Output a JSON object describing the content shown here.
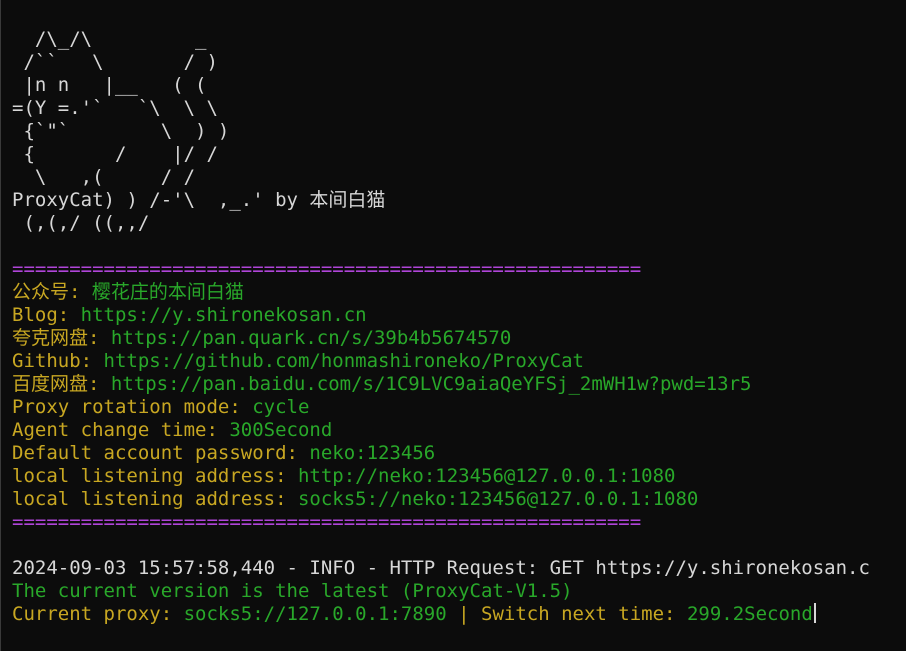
{
  "ascii_art": [
    "  /\\_/\\         _",
    " /``   \\       / )",
    " |n n   |__   ( (",
    "=(Y =.'`   `\\  \\ \\",
    " {`\"`        \\  ) )",
    " {       /    |/ /",
    "  \\   ,(     / /",
    "ProxyCat) ) /-'\\  ,_.' by 本间白猫",
    " (,(,/ ((,,/"
  ],
  "separator": "=======================================================",
  "info": [
    {
      "label": "公众号: ",
      "value": "樱花庄的本间白猫"
    },
    {
      "label": "Blog: ",
      "value": "https://y.shironekosan.cn"
    },
    {
      "label": "夸克网盘: ",
      "value": "https://pan.quark.cn/s/39b4b5674570"
    },
    {
      "label": "Github: ",
      "value": "https://github.com/honmashironeko/ProxyCat"
    },
    {
      "label": "百度网盘: ",
      "value": "https://pan.baidu.com/s/1C9LVC9aiaQeYFSj_2mWH1w?pwd=13r5"
    },
    {
      "label": "Proxy rotation mode: ",
      "value": "cycle"
    },
    {
      "label": "Agent change time: ",
      "value": "300Second"
    },
    {
      "label": "Default account password: ",
      "value": "neko:123456"
    },
    {
      "label": "local listening address: ",
      "value": "http://neko:123456@127.0.0.1:1080"
    },
    {
      "label": "local listening address: ",
      "value": "socks5://neko:123456@127.0.0.1:1080"
    }
  ],
  "log_line": "2024-09-03 15:57:58,440 - INFO - HTTP Request: GET https://y.shironekosan.c",
  "version_line": "The current version is the latest (ProxyCat-V1.5)",
  "status": {
    "proxy_label": "Current proxy: ",
    "proxy_value": "socks5://127.0.0.1:7890",
    "divider": " | ",
    "switch_label": "Switch next time: ",
    "switch_value": "299.2Second"
  }
}
